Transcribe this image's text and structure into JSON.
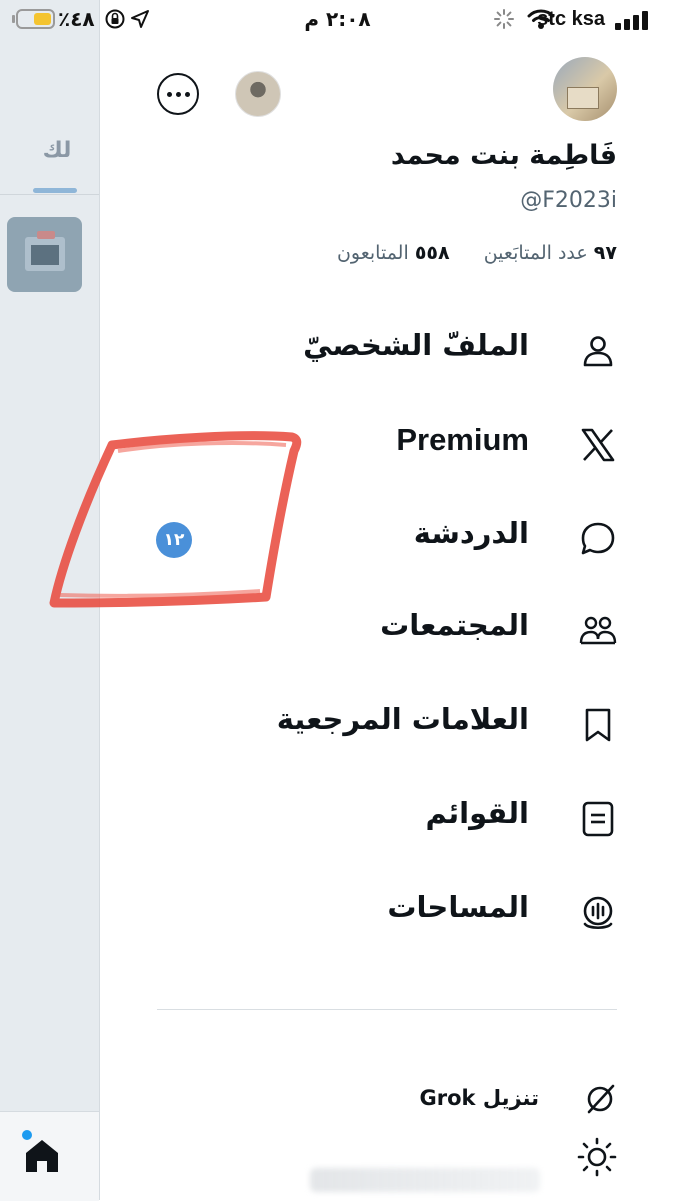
{
  "status_bar": {
    "carrier": "stc ksa",
    "time": "٢:٠٨ م",
    "battery_percent": "٪٤٨"
  },
  "background": {
    "tab_label": "لك"
  },
  "profile": {
    "display_name": "فَاطِمة بنت محمد",
    "handle": "@F2023i",
    "following_count": "٩٧",
    "following_label": "عدد المتابَعين",
    "followers_count": "٥٥٨",
    "followers_label": "المتابعون"
  },
  "menu": {
    "items": [
      {
        "label": "الملفّ الشخصيّ",
        "icon": "person-icon"
      },
      {
        "label": "Premium",
        "icon": "x-logo-icon"
      },
      {
        "label": "الدردشة",
        "icon": "chat-bubble-icon"
      },
      {
        "label": "المجتمعات",
        "icon": "communities-icon"
      },
      {
        "label": "العلامات المرجعية",
        "icon": "bookmark-icon"
      },
      {
        "label": "القوائم",
        "icon": "lists-icon"
      },
      {
        "label": "المساحات",
        "icon": "spaces-icon"
      }
    ],
    "chat_badge": "١٢"
  },
  "grok": {
    "label": "تنزيل Grok"
  },
  "colors": {
    "badge": "#4a90d9",
    "accent": "#1d9bf0",
    "scribble": "#e8473a"
  }
}
